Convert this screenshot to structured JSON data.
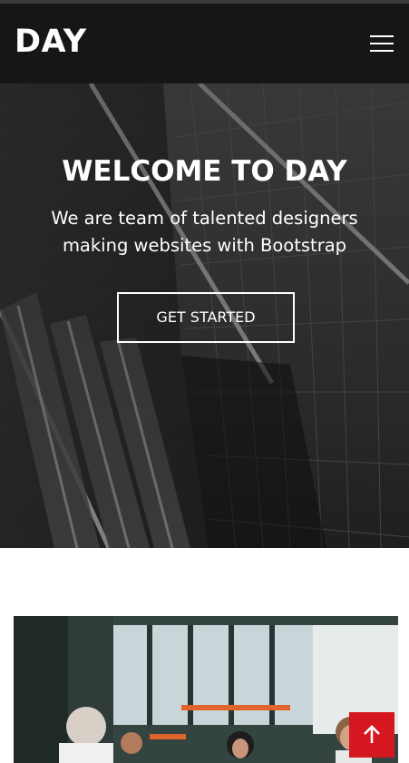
{
  "header": {
    "logo": "DAY",
    "menu_icon": "hamburger-menu-icon"
  },
  "hero": {
    "title": "WELCOME TO DAY",
    "subtitle": "We are team of talented designers making websites with Bootstrap",
    "cta_label": "GET STARTED"
  },
  "back_to_top": {
    "icon": "arrow-up-icon"
  },
  "colors": {
    "header_bg": "#161616",
    "accent": "#d5171f",
    "text_light": "#ffffff"
  }
}
